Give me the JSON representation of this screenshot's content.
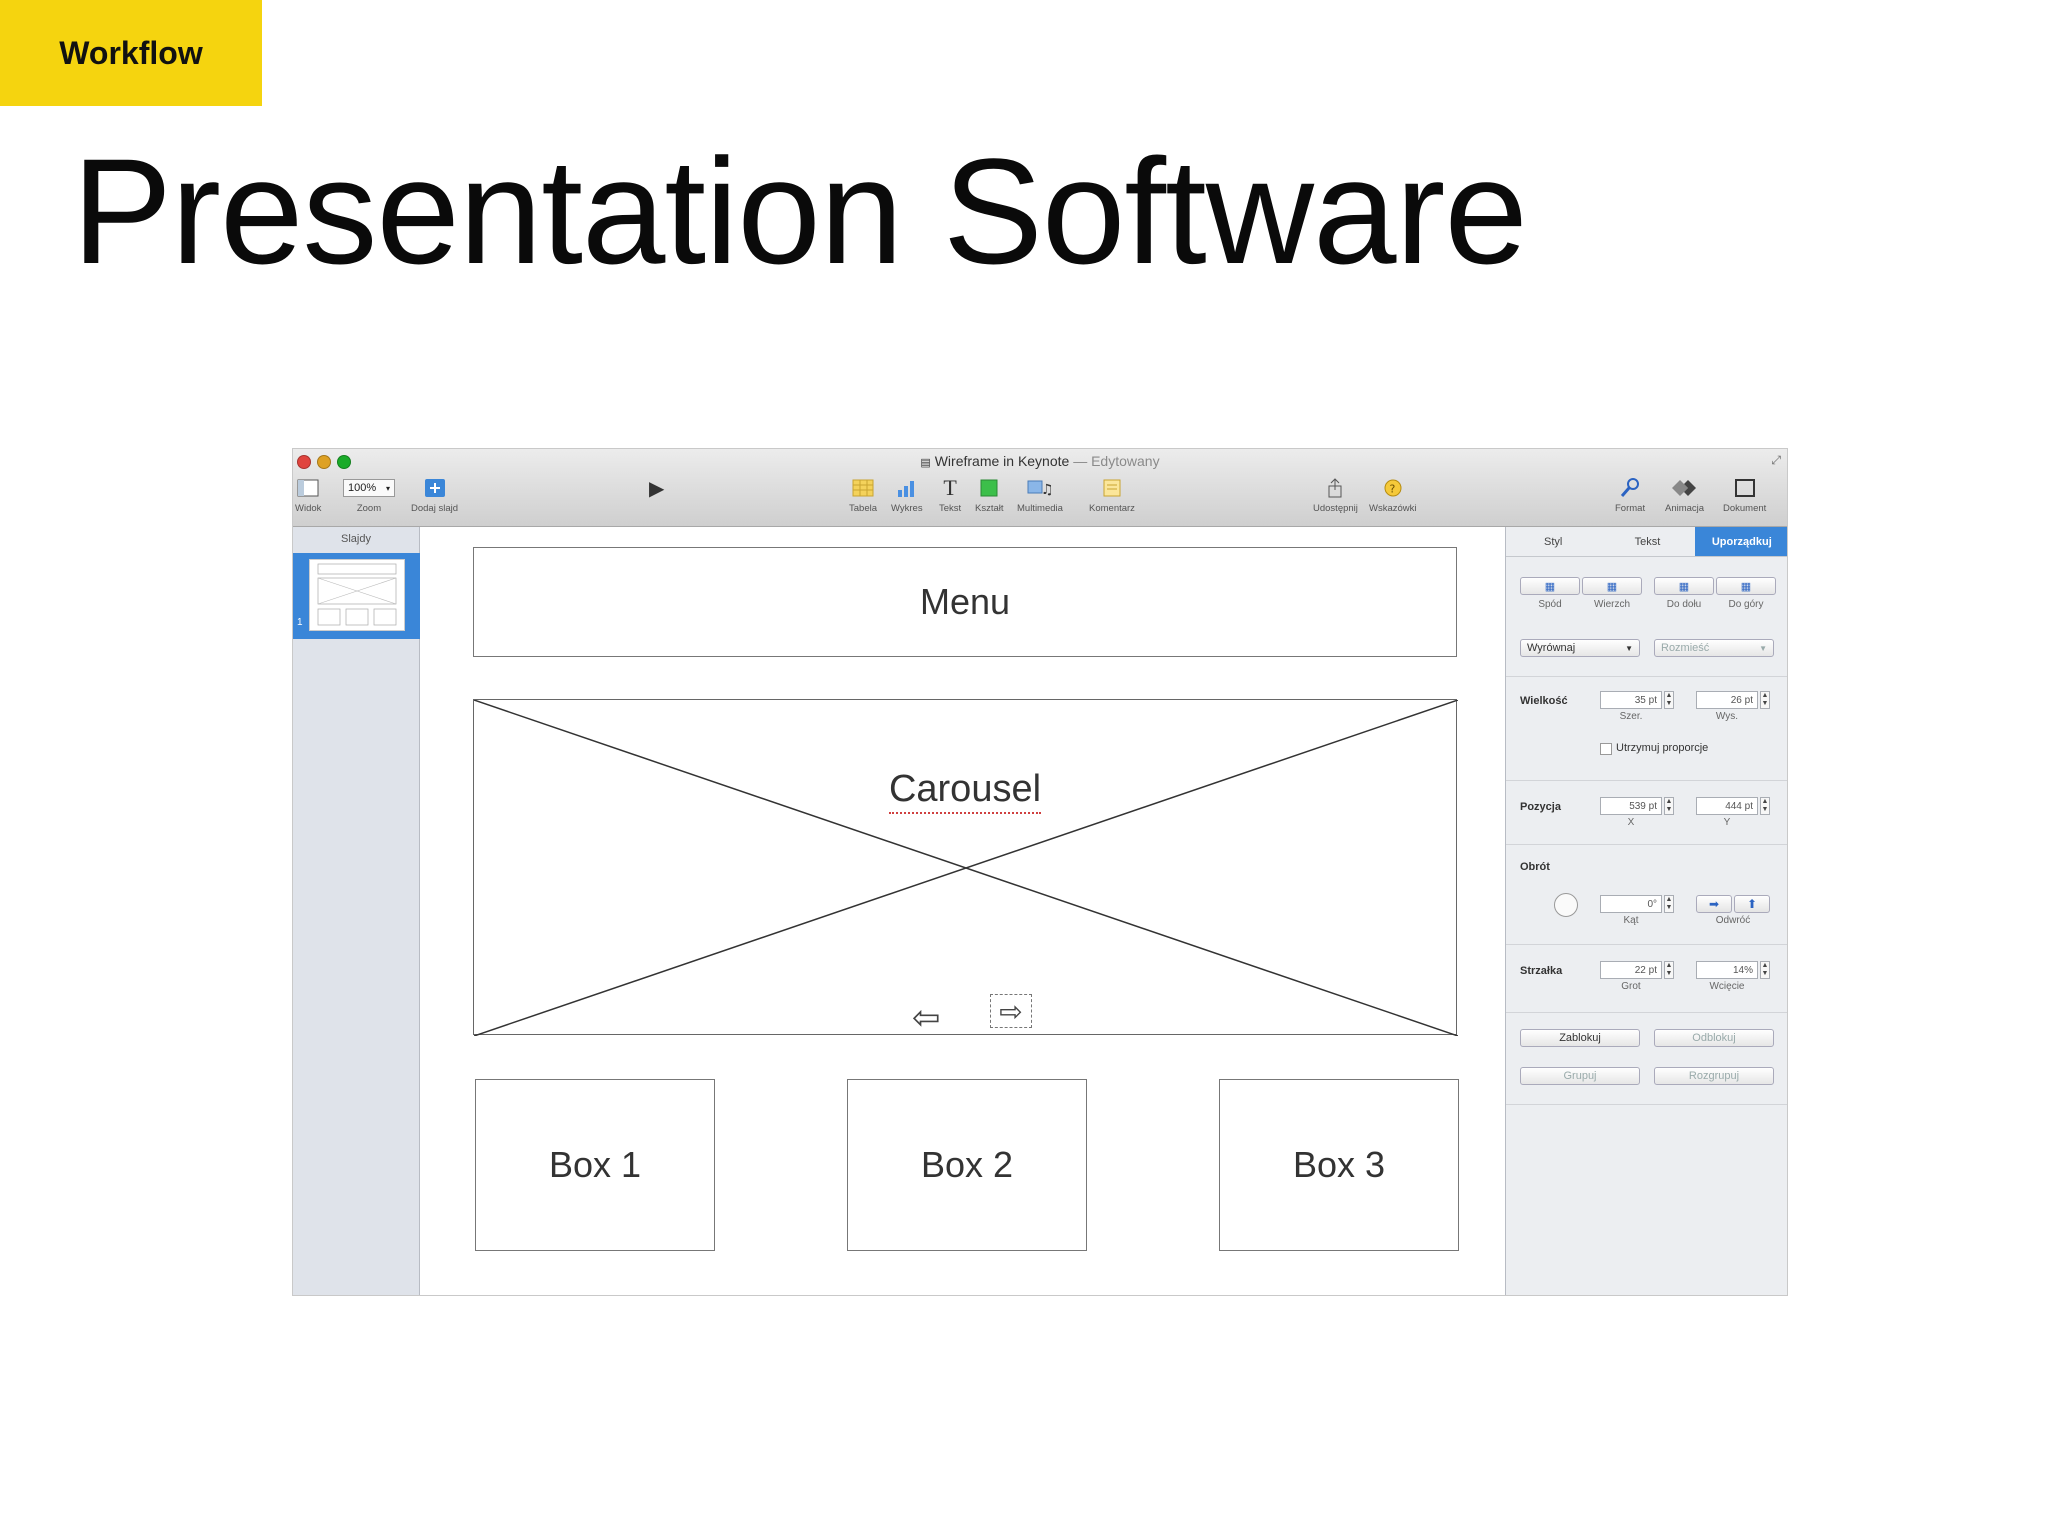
{
  "slide": {
    "tag": "Workflow",
    "title": "Presentation Software"
  },
  "window": {
    "doc_name": "Wireframe in Keynote",
    "separator": "—",
    "status": "Edytowany"
  },
  "toolbar": {
    "widok": "Widok",
    "zoom_value": "100%",
    "zoom": "Zoom",
    "dodaj_slajd": "Dodaj slajd",
    "tabela": "Tabela",
    "wykres": "Wykres",
    "tekst": "Tekst",
    "ksztalt": "Kształt",
    "multimedia": "Multimedia",
    "komentarz": "Komentarz",
    "udostepnij": "Udostępnij",
    "wskazowki": "Wskazówki",
    "format": "Format",
    "animacja": "Animacja",
    "dokument": "Dokument"
  },
  "navigator": {
    "label": "Slajdy",
    "slide_number": "1"
  },
  "canvas": {
    "menu": "Menu",
    "carousel": "Carousel",
    "box1": "Box 1",
    "box2": "Box 2",
    "box3": "Box 3"
  },
  "inspector": {
    "tabs": [
      "Styl",
      "Tekst",
      "Uporządkuj"
    ],
    "arrange": {
      "spod": "Spód",
      "wierzch": "Wierzch",
      "do_dolu": "Do dołu",
      "do_gory": "Do góry"
    },
    "wyrownaj": "Wyrównaj",
    "rozmiesc": "Rozmieść",
    "size": {
      "label": "Wielkość",
      "width": "35 pt",
      "width_label": "Szer.",
      "height": "26 pt",
      "height_label": "Wys.",
      "keep_ratio": "Utrzymuj proporcje"
    },
    "position": {
      "label": "Pozycja",
      "x": "539 pt",
      "x_label": "X",
      "y": "444 pt",
      "y_label": "Y"
    },
    "rotation": {
      "label": "Obrót",
      "angle": "0°",
      "angle_label": "Kąt",
      "flip_label": "Odwróć"
    },
    "arrow": {
      "label": "Strzałka",
      "head": "22 pt",
      "head_label": "Grot",
      "indent": "14%",
      "indent_label": "Wcięcie"
    },
    "zablokuj": "Zablokuj",
    "odblokuj": "Odblokuj",
    "grupuj": "Grupuj",
    "rozgrupuj": "Rozgrupuj"
  },
  "colors": {
    "tag_bg": "#f5d40f",
    "accent_blue": "#3a86d8",
    "close": "#e0443e",
    "minimize": "#dea123",
    "zoom": "#1aab29"
  }
}
